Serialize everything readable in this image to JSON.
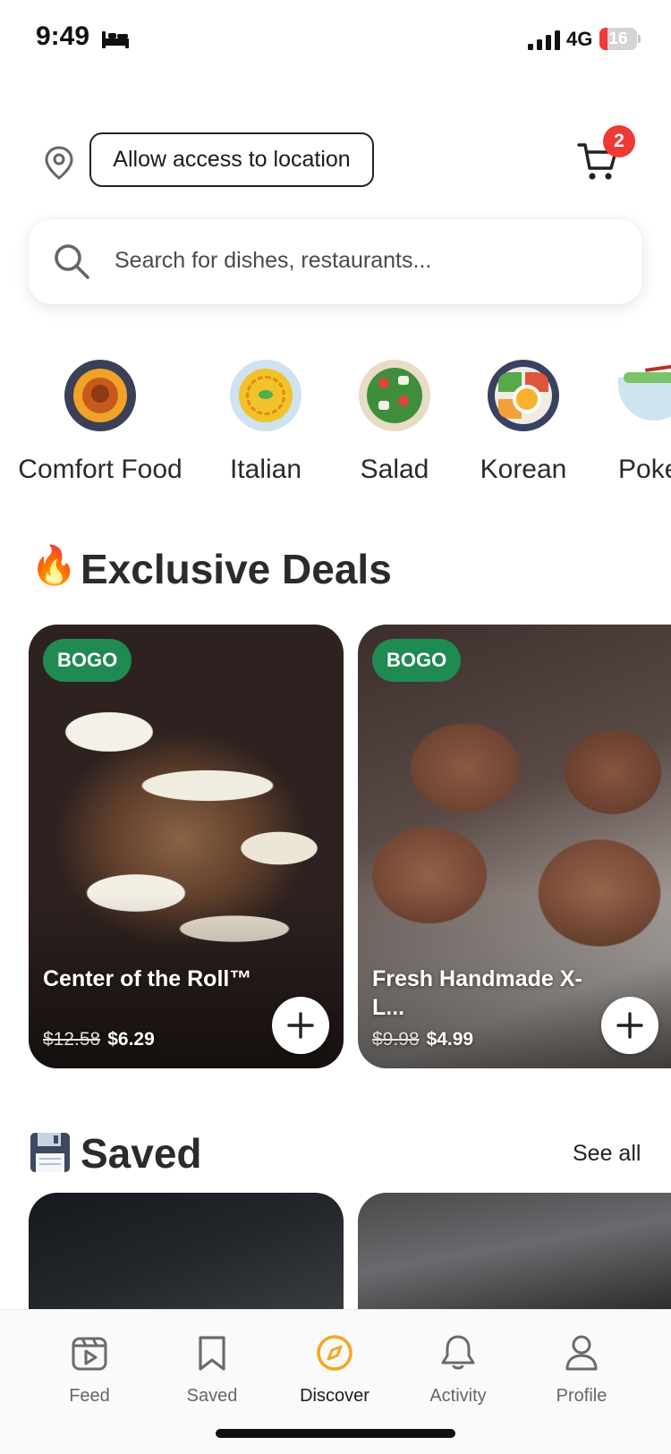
{
  "status_bar": {
    "time": "9:49",
    "network": "4G",
    "battery_level": "16"
  },
  "header": {
    "location_button": "Allow access to location",
    "cart_count": "2"
  },
  "search": {
    "placeholder": "Search for dishes, restaurants..."
  },
  "categories": [
    {
      "label": "Comfort Food",
      "icon": "comfort-food-icon"
    },
    {
      "label": "Italian",
      "icon": "italian-pasta-icon"
    },
    {
      "label": "Salad",
      "icon": "salad-icon"
    },
    {
      "label": "Korean",
      "icon": "korean-bibimbap-icon"
    },
    {
      "label": "Poke",
      "icon": "poke-bowl-icon"
    }
  ],
  "exclusive_deals": {
    "title": "Exclusive Deals",
    "emoji": "🔥",
    "items": [
      {
        "badge": "BOGO",
        "name": "Center of the Roll™",
        "old_price": "$12.58",
        "price": "$6.29"
      },
      {
        "badge": "BOGO",
        "name": "Fresh Handmade X-L...",
        "old_price": "$9.98",
        "price": "$4.99"
      }
    ]
  },
  "saved": {
    "title": "Saved",
    "emoji": "💾",
    "see_all": "See all"
  },
  "tabs": [
    {
      "label": "Feed",
      "icon": "feed-video-icon"
    },
    {
      "label": "Saved",
      "icon": "bookmark-icon"
    },
    {
      "label": "Discover",
      "icon": "compass-icon",
      "active": true
    },
    {
      "label": "Activity",
      "icon": "bell-icon"
    },
    {
      "label": "Profile",
      "icon": "person-icon"
    }
  ],
  "colors": {
    "accent": "#f5a623",
    "badge_green": "#1f8a52",
    "cart_badge": "#ee3a33"
  }
}
